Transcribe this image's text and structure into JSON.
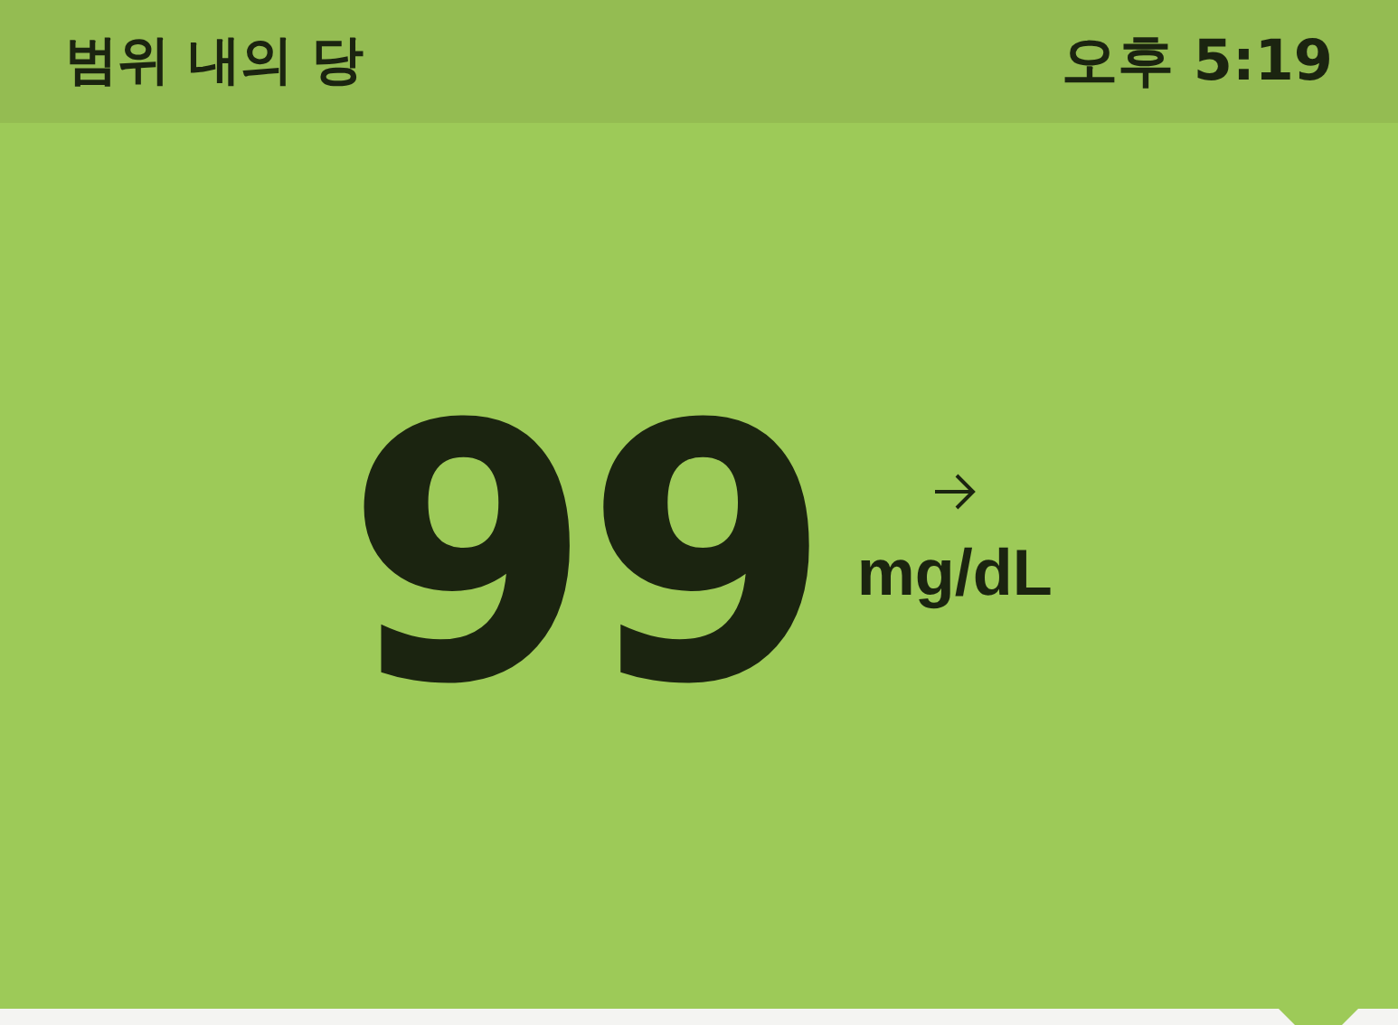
{
  "header": {
    "title": "범위 내의 당",
    "time": "오후 5:19"
  },
  "reading": {
    "value": "99",
    "unit": "mg/dL"
  }
}
